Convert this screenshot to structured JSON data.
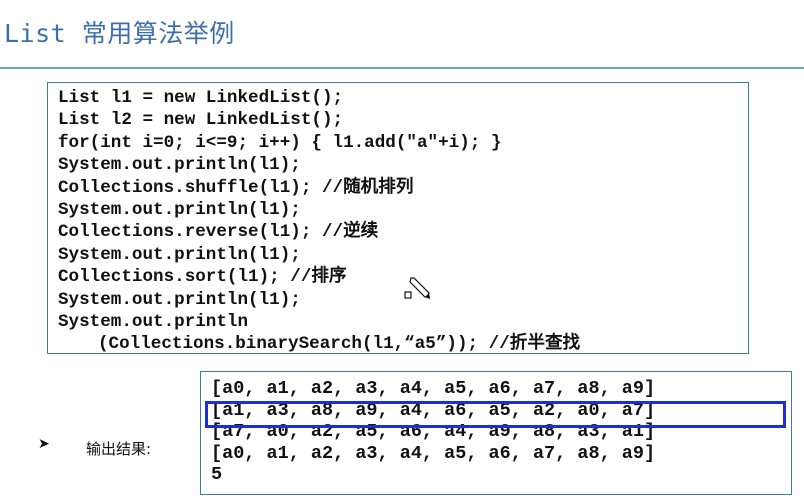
{
  "slide": {
    "title": "List 常用算法举例"
  },
  "code": {
    "lines": [
      "List l1 = new LinkedList();",
      "List l2 = new LinkedList();",
      "for(int i=0; i<=9; i++) { l1.add(\"a\"+i); }",
      "System.out.println(l1);",
      "Collections.shuffle(l1); //随机排列",
      "System.out.println(l1);",
      "Collections.reverse(l1); //逆续",
      "System.out.println(l1);",
      "Collections.sort(l1); //排序",
      "System.out.println(l1);",
      "System.out.println",
      "(Collections.binarySearch(l1,“a5”)); //折半查找"
    ]
  },
  "output": {
    "bullet_icon": "arrow-bullet-icon",
    "label": "输出结果:",
    "lines": [
      "[a0, a1, a2, a3, a4, a5, a6, a7, a8, a9]",
      "[a1, a3, a8, a9, a4, a6, a5, a2, a0, a7]",
      "[a7, a0, a2, a5, a6, a4, a9, a8, a3, a1]",
      "[a0, a1, a2, a3, a4, a5, a6, a7, a8, a9]",
      "5"
    ],
    "highlight_color": "#1a2fd6"
  },
  "cursor_icon": "pencil-cursor-icon",
  "colors": {
    "title": "#3f6fa8",
    "rule": "#5fa8b4",
    "box_border": "#3a7f95"
  }
}
